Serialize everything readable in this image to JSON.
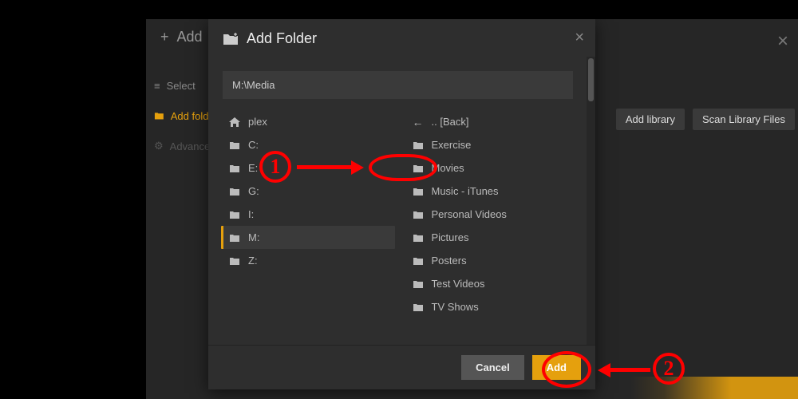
{
  "bg": {
    "title": "Add",
    "close": "×",
    "nav": {
      "select": "Select",
      "add_folder": "Add folder",
      "advanced": "Advanced"
    },
    "add_library": "Add library",
    "scan_library": "Scan Library Files"
  },
  "modal": {
    "title": "Add Folder",
    "close": "×",
    "path": "M:\\Media",
    "drives": {
      "home": "plex",
      "items": [
        "C:",
        "E:",
        "G:",
        "I:",
        "M:",
        "Z:"
      ],
      "selected": "M:"
    },
    "folders": {
      "back": ".. [Back]",
      "items": [
        "Exercise",
        "Movies",
        "Music - iTunes",
        "Personal Videos",
        "Pictures",
        "Posters",
        "Test Videos",
        "TV Shows"
      ]
    },
    "cancel": "Cancel",
    "add": "Add"
  },
  "annotation": {
    "one": "1",
    "two": "2"
  }
}
